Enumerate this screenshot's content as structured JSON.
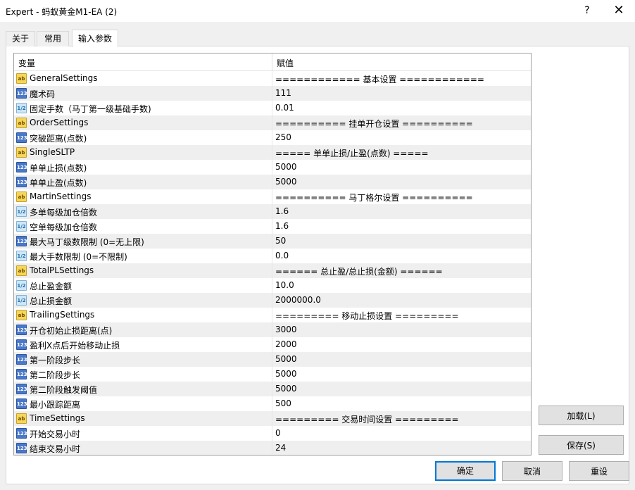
{
  "window": {
    "title": "Expert - 蚂蚁黄金M1-EA (2)",
    "help_label": "?",
    "close_label": "✕"
  },
  "tabs": [
    {
      "label": "关于",
      "active": false
    },
    {
      "label": "常用",
      "active": false
    },
    {
      "label": "输入参数",
      "active": true
    }
  ],
  "grid": {
    "headers": {
      "variable": "变量",
      "value": "赋值"
    },
    "rows": [
      {
        "type": "ab",
        "icon_label": "ab",
        "name": "GeneralSettings",
        "value": "============ 基本设置 ============"
      },
      {
        "type": "int",
        "icon_label": "123",
        "name": "魔术码",
        "value": "111"
      },
      {
        "type": "dbl",
        "icon_label": "1/2",
        "name": "固定手数（马丁第一级基础手数)",
        "value": "0.01"
      },
      {
        "type": "ab",
        "icon_label": "ab",
        "name": "OrderSettings",
        "value": "========== 挂单开仓设置 =========="
      },
      {
        "type": "int",
        "icon_label": "123",
        "name": "突破距离(点数)",
        "value": "250"
      },
      {
        "type": "ab",
        "icon_label": "ab",
        "name": "SingleSLTP",
        "value": "===== 单单止损/止盈(点数) ====="
      },
      {
        "type": "int",
        "icon_label": "123",
        "name": "单单止损(点数)",
        "value": "5000"
      },
      {
        "type": "int",
        "icon_label": "123",
        "name": "单单止盈(点数)",
        "value": "5000"
      },
      {
        "type": "ab",
        "icon_label": "ab",
        "name": "MartinSettings",
        "value": "========== 马丁格尔设置 =========="
      },
      {
        "type": "dbl",
        "icon_label": "1/2",
        "name": "多单每级加仓倍数",
        "value": "1.6"
      },
      {
        "type": "dbl",
        "icon_label": "1/2",
        "name": "空单每级加仓倍数",
        "value": "1.6"
      },
      {
        "type": "int",
        "icon_label": "123",
        "name": "最大马丁级数限制 (0=无上限)",
        "value": "50"
      },
      {
        "type": "dbl",
        "icon_label": "1/2",
        "name": "最大手数限制 (0=不限制)",
        "value": "0.0"
      },
      {
        "type": "ab",
        "icon_label": "ab",
        "name": "TotalPLSettings",
        "value": "====== 总止盈/总止损(金额) ======"
      },
      {
        "type": "dbl",
        "icon_label": "1/2",
        "name": "总止盈金额",
        "value": "10.0"
      },
      {
        "type": "dbl",
        "icon_label": "1/2",
        "name": "总止损金额",
        "value": "2000000.0"
      },
      {
        "type": "ab",
        "icon_label": "ab",
        "name": "TrailingSettings",
        "value": "========= 移动止损设置 ========="
      },
      {
        "type": "int",
        "icon_label": "123",
        "name": "开仓初始止损距离(点)",
        "value": "3000"
      },
      {
        "type": "int",
        "icon_label": "123",
        "name": "盈利X点后开始移动止损",
        "value": "2000"
      },
      {
        "type": "int",
        "icon_label": "123",
        "name": "第一阶段步长",
        "value": "5000"
      },
      {
        "type": "int",
        "icon_label": "123",
        "name": "第二阶段步长",
        "value": "5000"
      },
      {
        "type": "int",
        "icon_label": "123",
        "name": "第二阶段触发阈值",
        "value": "5000"
      },
      {
        "type": "int",
        "icon_label": "123",
        "name": "最小跟踪距离",
        "value": "500"
      },
      {
        "type": "ab",
        "icon_label": "ab",
        "name": "TimeSettings",
        "value": "========= 交易时间设置 ========="
      },
      {
        "type": "int",
        "icon_label": "123",
        "name": "开始交易小时",
        "value": "0"
      },
      {
        "type": "int",
        "icon_label": "123",
        "name": "结束交易小时",
        "value": "24"
      }
    ]
  },
  "buttons": {
    "load": "加载(L)",
    "save": "保存(S)",
    "ok": "确定",
    "cancel": "取消",
    "reset": "重设"
  },
  "colors": {
    "accent": "#0078d7",
    "row_alt": "#efefef"
  }
}
